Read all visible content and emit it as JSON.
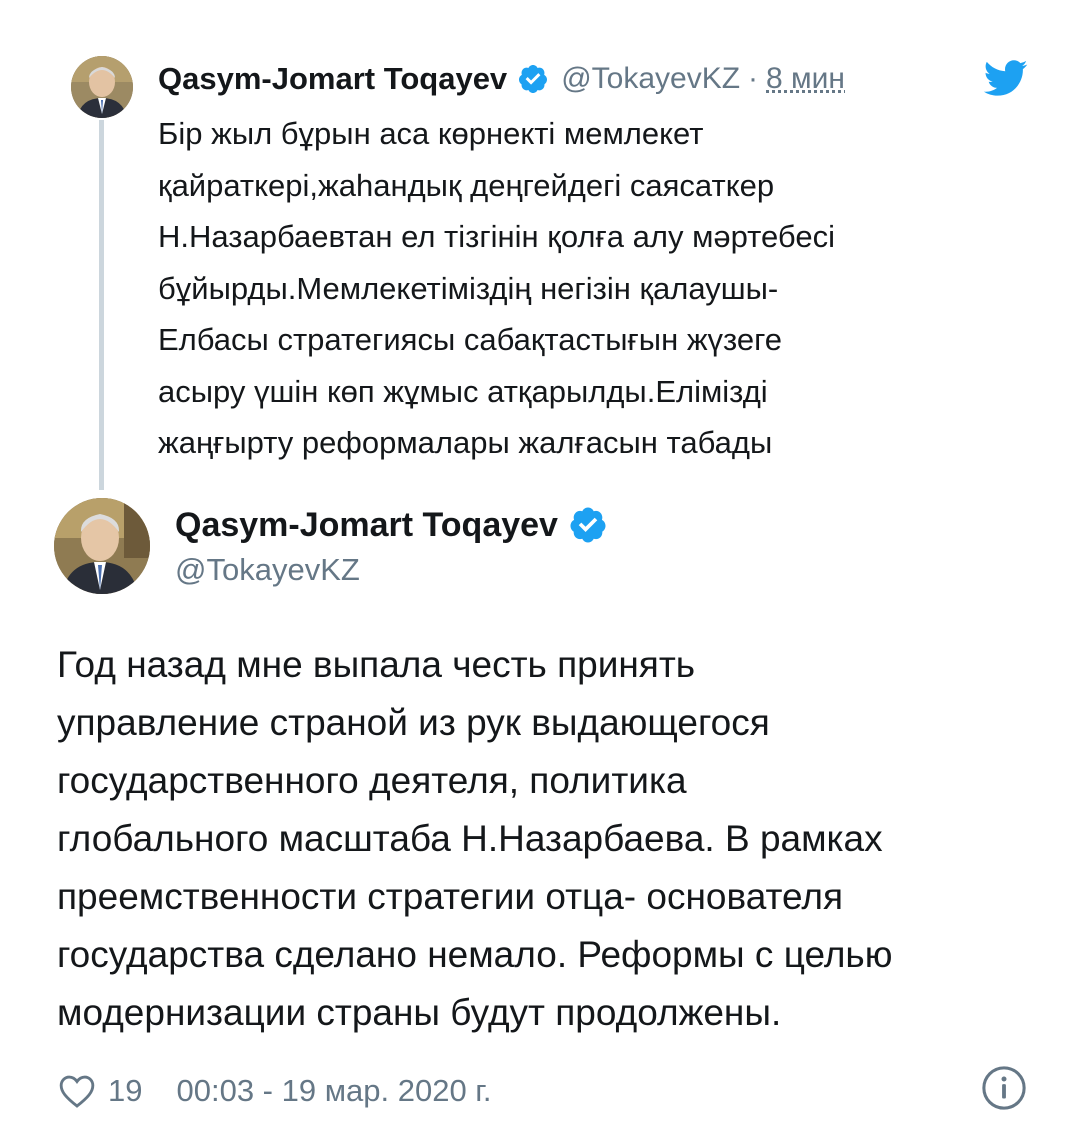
{
  "reply_tweet": {
    "author_name": "Qasym-Jomart Toqayev",
    "handle": "@TokayevKZ",
    "separator": "·",
    "time": "8 мин",
    "text": "Бір жыл бұрын аса көрнекті мемлекет\nқайраткері,жаһандық деңгейдегі саясаткер\nН.Назарбаевтан ел тізгінін қолға алу мәртебесі\nбұйырды.Мемлекетіміздің негізін қалаушы-\nЕлбасы стратегиясы сабақтастығын жүзеге\nасыру үшін көп жұмыс атқарылды.Елімізді\nжаңғырту реформалары жалғасын табады"
  },
  "main_tweet": {
    "author_name": "Qasym-Jomart Toqayev",
    "handle": "@TokayevKZ",
    "text": "Год назад мне выпала честь принять\nуправление страной из рук выдающегося\nгосударственного деятеля, политика\nглобального масштаба Н.Назарбаева. В рамках\nпреемственности стратегии отца- основателя\nгосударства сделано немало. Реформы с целью\nмодернизации страны будут продолжены."
  },
  "footer": {
    "like_count": "19",
    "timestamp": "00:03 - 19 мар. 2020 г."
  },
  "icons": {
    "verified": "verified-badge-icon",
    "brand": "twitter-bird-icon",
    "like": "heart-icon",
    "info": "info-icon"
  },
  "colors": {
    "verified_blue": "#1da1f2",
    "text_primary": "#14171a",
    "text_secondary": "#657786",
    "thread_line": "#ccd6dd"
  }
}
